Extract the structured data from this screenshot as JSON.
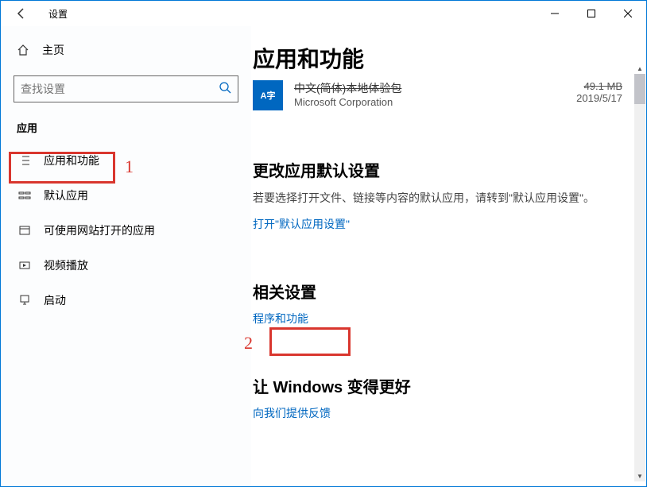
{
  "window": {
    "title": "设置"
  },
  "sidebar": {
    "home": "主页",
    "search_placeholder": "查找设置",
    "section": "应用",
    "items": [
      {
        "label": "应用和功能"
      },
      {
        "label": "默认应用"
      },
      {
        "label": "可使用网站打开的应用"
      },
      {
        "label": "视频播放"
      },
      {
        "label": "启动"
      }
    ]
  },
  "main": {
    "heading": "应用和功能",
    "app": {
      "icon_text": "A字",
      "name": "中文(简体)本地体验包",
      "publisher": "Microsoft Corporation",
      "size": "49.1 MB",
      "date": "2019/5/17"
    },
    "change_defaults": {
      "title": "更改应用默认设置",
      "desc": "若要选择打开文件、链接等内容的默认应用，请转到\"默认应用设置\"。",
      "link": "打开\"默认应用设置\""
    },
    "related": {
      "title": "相关设置",
      "link": "程序和功能"
    },
    "improve": {
      "title": "让 Windows 变得更好",
      "link": "向我们提供反馈"
    }
  },
  "annotations": {
    "one": "1",
    "two": "2"
  }
}
